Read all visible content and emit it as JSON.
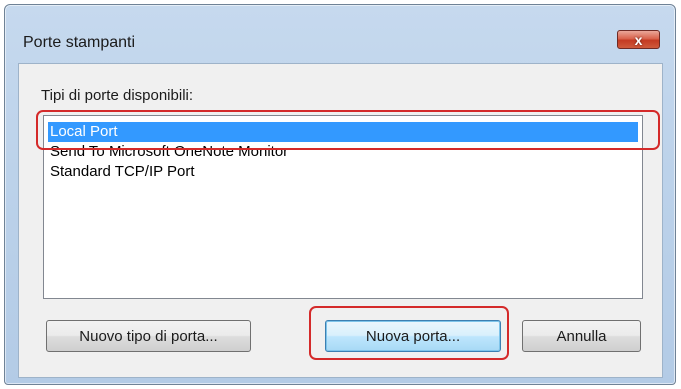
{
  "window": {
    "title": "Porte stampanti",
    "close_label": "x"
  },
  "list": {
    "label": "Tipi di porte disponibili:",
    "items": [
      {
        "label": "Local Port",
        "selected": true
      },
      {
        "label": "Send To Microsoft OneNote Monitor",
        "selected": false
      },
      {
        "label": "Standard TCP/IP Port",
        "selected": false
      }
    ]
  },
  "buttons": {
    "new_port_type": "Nuovo tipo di porta...",
    "new_port": "Nuova porta...",
    "cancel": "Annulla"
  },
  "colors": {
    "selection": "#3399ff",
    "highlight_ring": "#d42a2a",
    "close_button": "#c43a22"
  }
}
